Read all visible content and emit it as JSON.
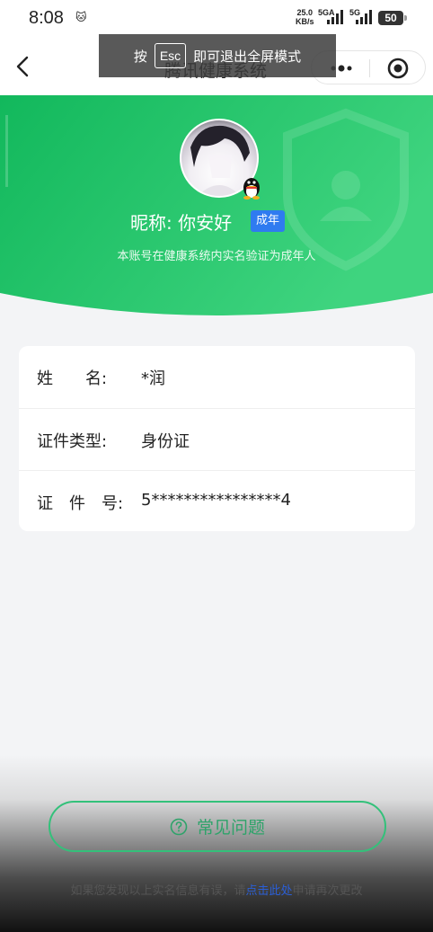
{
  "status_bar": {
    "time": "8:08",
    "speed_value": "25.0",
    "speed_unit": "KB/s",
    "network_1": "5GA",
    "network_2": "5G",
    "battery": "50"
  },
  "nav": {
    "title": "腾讯健康系统",
    "toast_prefix": "按",
    "toast_key": "Esc",
    "toast_suffix": "即可退出全屏模式"
  },
  "profile": {
    "nickname": "昵称: 你安好",
    "badge": "成年",
    "verify_note": "本账号在健康系统内实名验证为成年人"
  },
  "info": {
    "rows": [
      {
        "label": "姓　　名:",
        "value": "*润"
      },
      {
        "label": "证件类型:",
        "value": "身份证"
      },
      {
        "label": "证　件　号:",
        "value": "5****************4"
      }
    ]
  },
  "faq": {
    "label": "常见问题"
  },
  "footer": {
    "before": "如果您发现以上实名信息有误，请",
    "link": "点击此处",
    "after": "申请再次更改"
  },
  "colors": {
    "green": "#1fc36a",
    "badge_blue": "#2f7bf0",
    "link_blue": "#2b5fd6"
  }
}
